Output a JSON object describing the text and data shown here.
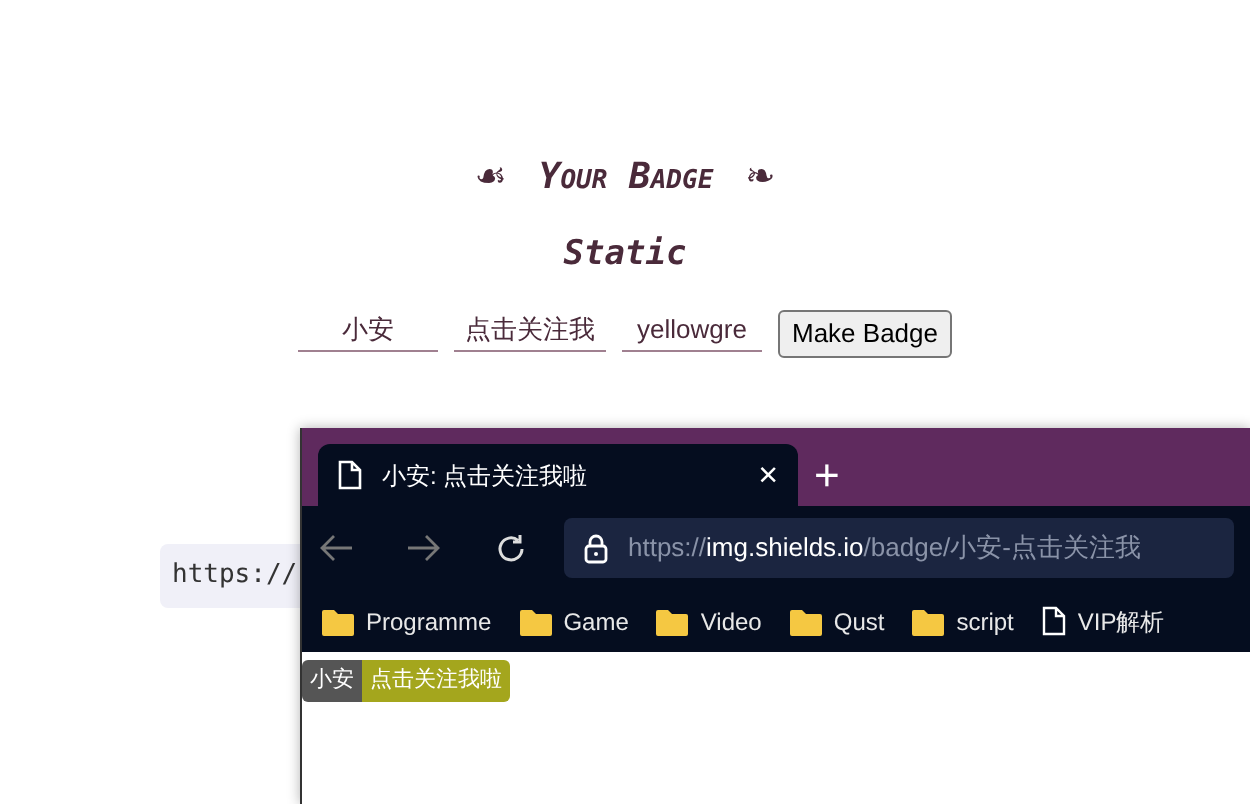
{
  "heading": {
    "ornament_left": "☙",
    "text": "Your Badge",
    "ornament_right": "❧"
  },
  "subheading": "Static",
  "form": {
    "fields": [
      {
        "value": "小安"
      },
      {
        "value": "点击关注我"
      },
      {
        "value": "yellowgre"
      }
    ],
    "button": "Make Badge"
  },
  "code": "https://",
  "browser": {
    "tab": {
      "title": "小安: 点击关注我啦",
      "close": "×"
    },
    "new_tab": "+",
    "address": {
      "scheme": "https://",
      "host": "img.shields.io",
      "path": "/badge/小安-点击关注我"
    },
    "bookmarks": [
      {
        "kind": "folder",
        "label": "Programme"
      },
      {
        "kind": "folder",
        "label": "Game"
      },
      {
        "kind": "folder",
        "label": "Video"
      },
      {
        "kind": "folder",
        "label": "Qust"
      },
      {
        "kind": "folder",
        "label": "script"
      },
      {
        "kind": "page",
        "label": "VIP解析"
      }
    ],
    "badge": {
      "label": "小安",
      "message": "点击关注我啦",
      "color": "#a4a61d"
    }
  }
}
